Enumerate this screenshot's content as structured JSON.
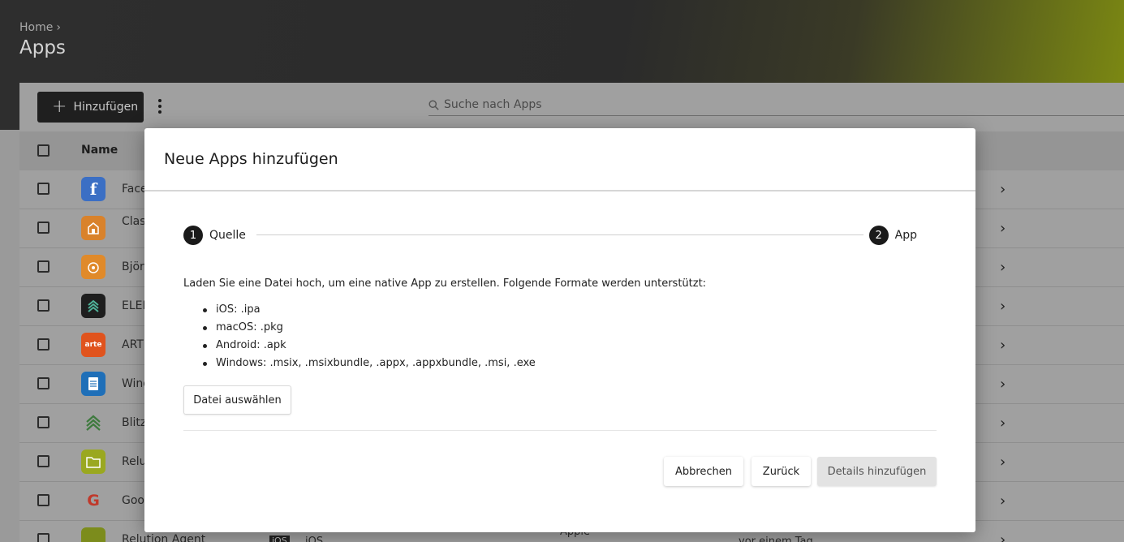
{
  "header": {
    "breadcrumb": "Home",
    "breadcrumb_separator": "›",
    "title": "Apps"
  },
  "toolbar": {
    "add_label": "Hinzufügen",
    "add_icon": "plus-icon",
    "more_icon": "more-vertical-icon",
    "search_placeholder": "Suche nach Apps",
    "search_icon": "search-icon"
  },
  "table": {
    "columns": [
      "Name"
    ],
    "rows": [
      {
        "name": "Face",
        "icon_label": "f",
        "icon_color": "#3b6fc4"
      },
      {
        "name": "Class Man",
        "icon_label": "",
        "icon_color": "#d9822b"
      },
      {
        "name": "Björk",
        "icon_label": "",
        "icon_color": "#e08a2a"
      },
      {
        "name": "ELEM",
        "icon_label": "",
        "icon_color": "#1e1e1e"
      },
      {
        "name": "ARTE",
        "icon_label": "arte",
        "icon_color": "#e0531d"
      },
      {
        "name": "Wind",
        "icon_label": "",
        "icon_color": "#1f6fb8"
      },
      {
        "name": "Blitz",
        "icon_label": "",
        "icon_color": "#8a8a8a"
      },
      {
        "name": "Relu",
        "icon_label": "",
        "icon_color": "#9aa820"
      },
      {
        "name": "Goog",
        "icon_label": "G",
        "icon_color": "#8a8a8a"
      },
      {
        "name": "Relution Agent",
        "icon_label": "",
        "icon_color": "#7c8c1c",
        "platform_badge": "iOS",
        "platform": "iOS",
        "vendor": "Apple",
        "updated": "vor einem Tag"
      }
    ],
    "row_chevron_icon": "chevron-right-icon"
  },
  "modal": {
    "title": "Neue Apps hinzufügen",
    "steps": [
      {
        "number": "1",
        "label": "Quelle"
      },
      {
        "number": "2",
        "label": "App"
      }
    ],
    "intro": "Laden Sie eine Datei hoch, um eine native App zu erstellen. Folgende Formate werden unterstützt:",
    "formats": [
      "iOS: .ipa",
      "macOS: .pkg",
      "Android: .apk",
      "Windows: .msix, .msixbundle, .appx, .appxbundle, .msi, .exe"
    ],
    "file_button": "Datei auswählen",
    "buttons": {
      "cancel": "Abbrechen",
      "back": "Zurück",
      "details": "Details hinzufügen"
    }
  }
}
